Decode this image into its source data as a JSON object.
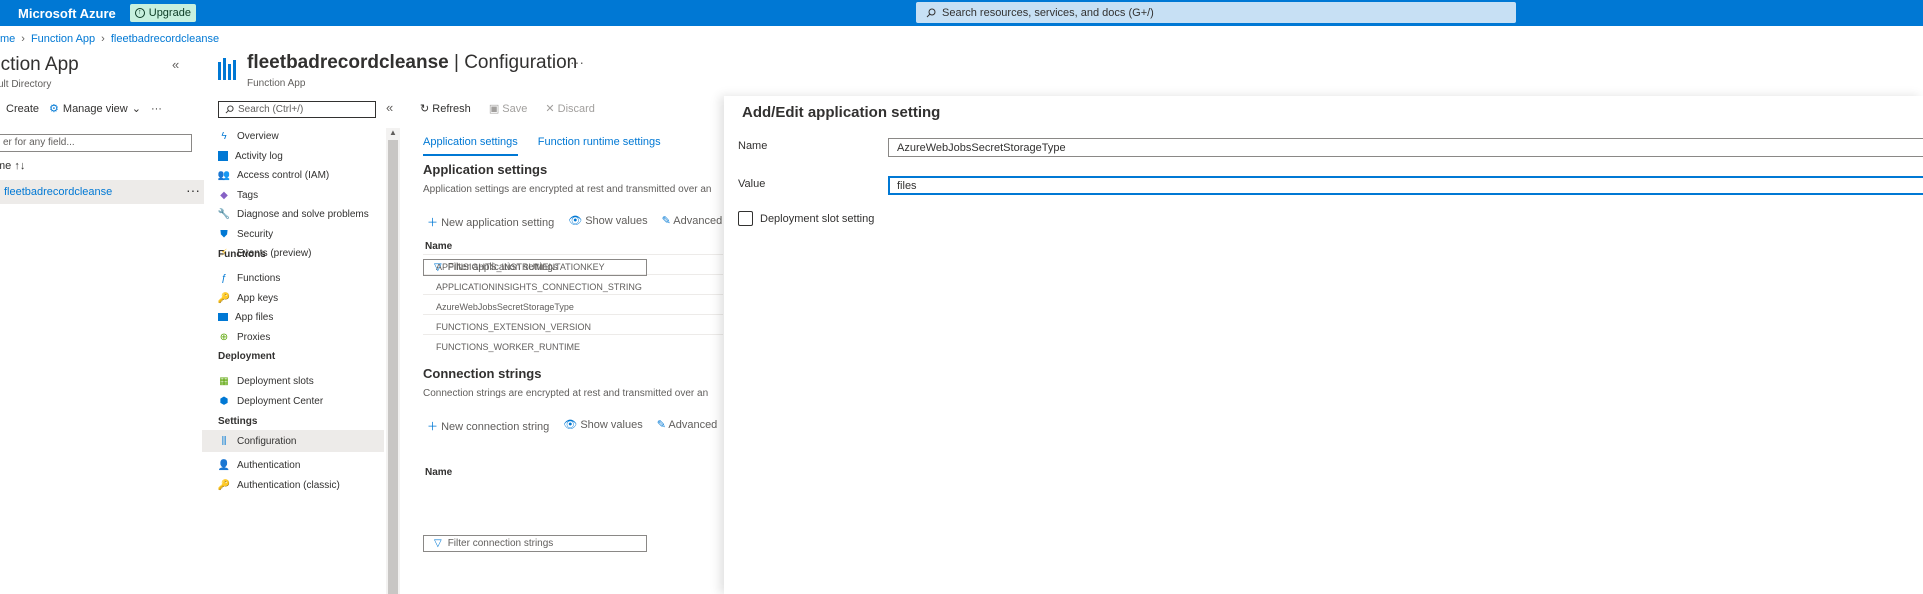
{
  "topbar": {
    "brand": "Microsoft Azure",
    "upgrade_label": "Upgrade",
    "search_placeholder": "Search resources, services, and docs (G+/)"
  },
  "breadcrumb": [
    "me",
    "Function App",
    "fleetbadrecordcleanse"
  ],
  "left_panel": {
    "title": "nction App",
    "subtitle": "ult Directory",
    "toolbar": {
      "create": "Create",
      "manage_view": "Manage view",
      "more": "···"
    },
    "filter_placeholder": "er for any field...",
    "sort_header": "me ↑↓",
    "rows": [
      {
        "name": "fleetbadrecordcleanse"
      }
    ]
  },
  "resource": {
    "name": "fleetbadrecordcleanse",
    "separator": " | ",
    "page": "Configuration",
    "type": "Function App",
    "more": "···"
  },
  "nav": {
    "search_placeholder": "Search (Ctrl+/)",
    "items": [
      {
        "label": "Overview"
      },
      {
        "label": "Activity log"
      },
      {
        "label": "Access control (IAM)"
      },
      {
        "label": "Tags"
      },
      {
        "label": "Diagnose and solve problems"
      },
      {
        "label": "Security"
      },
      {
        "label": "Events (preview)"
      }
    ],
    "sections": {
      "functions": "Functions",
      "deployment": "Deployment",
      "settings": "Settings"
    },
    "functions_items": [
      {
        "label": "Functions"
      },
      {
        "label": "App keys"
      },
      {
        "label": "App files"
      },
      {
        "label": "Proxies"
      }
    ],
    "deployment_items": [
      {
        "label": "Deployment slots"
      },
      {
        "label": "Deployment Center"
      }
    ],
    "settings_items": [
      {
        "label": "Configuration"
      },
      {
        "label": "Authentication"
      },
      {
        "label": "Authentication (classic)"
      }
    ]
  },
  "main": {
    "cmd": {
      "refresh": "Refresh",
      "save": "Save",
      "discard": "Discard"
    },
    "tabs": [
      "Application settings",
      "Function runtime settings"
    ],
    "app_settings": {
      "title": "Application settings",
      "desc": "Application settings are encrypted at rest and transmitted over an",
      "new_label": "New application setting",
      "show_values": "Show values",
      "advanced": "Advanced",
      "filter_placeholder": "Filter application settings",
      "col_name": "Name",
      "rows": [
        "APPINSIGHTS_INSTRUMENTATIONKEY",
        "APPLICATIONINSIGHTS_CONNECTION_STRING",
        "AzureWebJobsSecretStorageType",
        "FUNCTIONS_EXTENSION_VERSION",
        "FUNCTIONS_WORKER_RUNTIME"
      ]
    },
    "conn_strings": {
      "title": "Connection strings",
      "desc": "Connection strings are encrypted at rest and transmitted over an",
      "new_label": "New connection string",
      "show_values": "Show values",
      "advanced": "Advanced",
      "filter_placeholder": "Filter connection strings",
      "col_name": "Name"
    }
  },
  "blade": {
    "title": "Add/Edit application setting",
    "name_label": "Name",
    "name_value": "AzureWebJobsSecretStorageType",
    "value_label": "Value",
    "value_value": "files",
    "slot_setting_label": "Deployment slot setting",
    "slot_setting_checked": false
  },
  "colors": {
    "accent": "#0078d4",
    "topbar": "#0078d4",
    "upgrade_bg": "#c7f0de"
  }
}
